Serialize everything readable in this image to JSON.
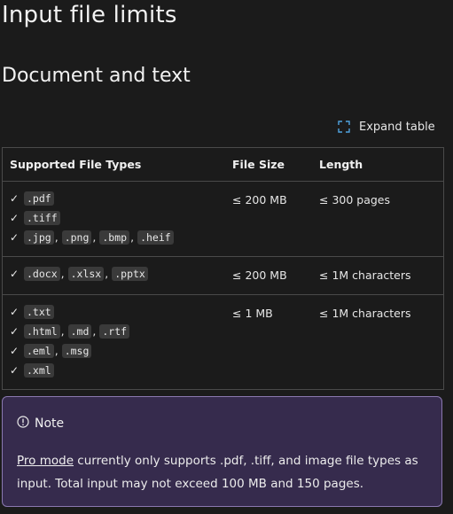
{
  "page": {
    "title": "Input file limits",
    "section_title": "Document and text",
    "expand_label": "Expand table"
  },
  "table": {
    "headers": [
      "Supported File Types",
      "File Size",
      "Length"
    ],
    "rows": [
      {
        "types": [
          [
            "pdf_ext"
          ],
          [
            "tiff_ext"
          ],
          [
            "jpg_ext",
            "png_ext",
            "bmp_ext",
            "heif_ext"
          ]
        ],
        "size": "≤ 200 MB",
        "length": "≤ 300 pages"
      },
      {
        "types": [
          [
            "docx_ext",
            "xlsx_ext",
            "pptx_ext"
          ]
        ],
        "size": "≤ 200 MB",
        "length": "≤ 1M characters"
      },
      {
        "types": [
          [
            "txt_ext"
          ],
          [
            "html_ext",
            "md_ext",
            "rtf_ext"
          ],
          [
            "eml_ext",
            "msg_ext"
          ],
          [
            "xml_ext"
          ]
        ],
        "size": "≤ 1 MB",
        "length": "≤ 1M characters"
      }
    ],
    "ext": {
      "pdf_ext": ".pdf",
      "tiff_ext": ".tiff",
      "jpg_ext": ".jpg",
      "png_ext": ".png",
      "bmp_ext": ".bmp",
      "heif_ext": ".heif",
      "docx_ext": ".docx",
      "xlsx_ext": ".xlsx",
      "pptx_ext": ".pptx",
      "txt_ext": ".txt",
      "html_ext": ".html",
      "md_ext": ".md",
      "rtf_ext": ".rtf",
      "eml_ext": ".eml",
      "msg_ext": ".msg",
      "xml_ext": ".xml"
    },
    "check_glyph": "✓",
    "separator": ","
  },
  "note": {
    "icon": "info-circle-icon",
    "label": "Note",
    "link_text": "Pro mode",
    "body_text": " currently only supports .pdf, .tiff, and image file types as input. Total input may not exceed 100 MB and 150 pages."
  },
  "colors": {
    "background": "#1b1b1b",
    "note_background": "#362b4d",
    "note_border": "#8a78b0",
    "code_background": "#3a3a3a",
    "expand_icon": "#4fa3e0"
  }
}
